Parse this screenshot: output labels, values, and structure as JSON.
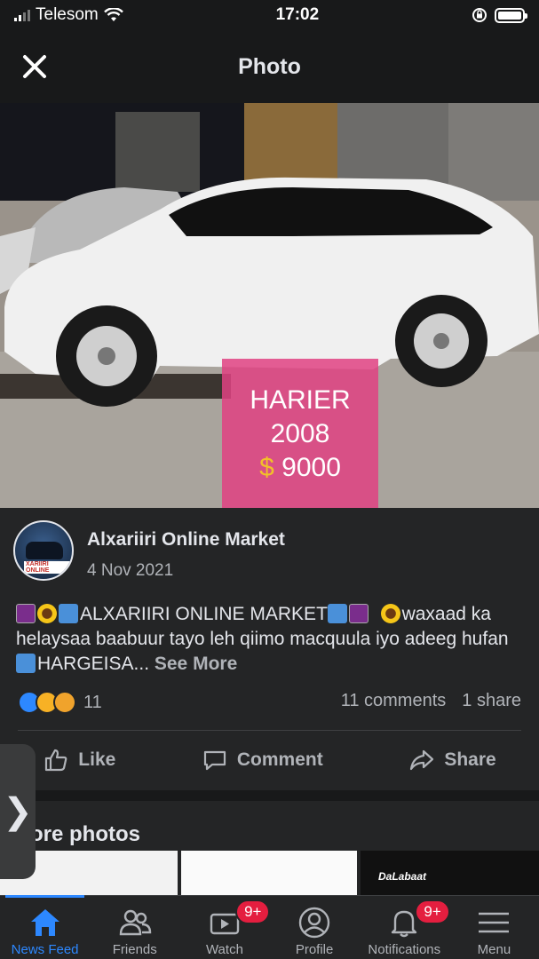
{
  "status_bar": {
    "carrier": "Telesom",
    "time": "17:02"
  },
  "header": {
    "title": "Photo"
  },
  "photo": {
    "price_model": "HARIER",
    "price_year": "2008",
    "price_symbol": "$",
    "price_value": "9000",
    "accent_color": "#e14282"
  },
  "post": {
    "author": "Alxariiri Online Market",
    "date": "4 Nov 2021",
    "avatar_tag": "XARIIRI ONLINE",
    "caption_part1": "ALXARIIRI ONLINE MARKET",
    "caption_part2": "waxaad ka helaysaa baabuur tayo leh qiimo macquula iyo adeeg hufan",
    "caption_part3": "HARGEISA...",
    "see_more": "See More",
    "reaction_count": "11",
    "comments": "11 comments",
    "shares": "1 share"
  },
  "actions": {
    "like": "Like",
    "comment": "Comment",
    "share": "Share"
  },
  "more_photos": {
    "title": "ore photos",
    "thumb3_brand": "DaLabaat"
  },
  "side_tab": {
    "icon": "chevron-right-icon",
    "glyph": "❯"
  },
  "nav": {
    "items": [
      {
        "label": "News Feed",
        "icon": "home-icon"
      },
      {
        "label": "Friends",
        "icon": "friends-icon"
      },
      {
        "label": "Watch",
        "icon": "watch-icon",
        "badge": "9+"
      },
      {
        "label": "Profile",
        "icon": "profile-icon"
      },
      {
        "label": "Notifications",
        "icon": "bell-icon",
        "badge": "9+"
      },
      {
        "label": "Menu",
        "icon": "menu-icon"
      }
    ]
  }
}
